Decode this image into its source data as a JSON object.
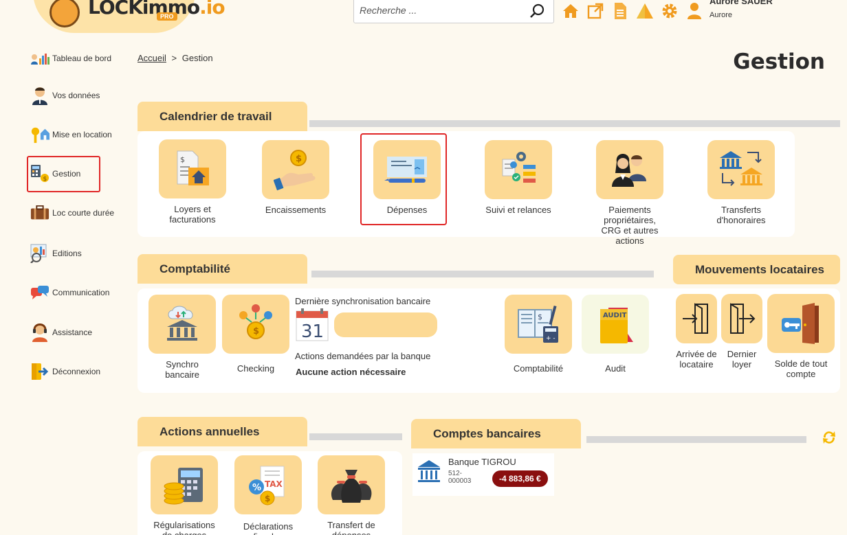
{
  "header": {
    "logo_main": "LOCKimmo",
    "logo_io": ".io",
    "logo_badge": "PRO",
    "search_placeholder": "Recherche ...",
    "user_name": "Aurore SAUER",
    "user_sub": "Aurore",
    "icons": [
      "home-icon",
      "external-link-icon",
      "document-icon",
      "alert-triangle-icon",
      "gear-icon",
      "user-icon"
    ]
  },
  "sidebar": {
    "items": [
      {
        "label": "Tableau de bord",
        "icon": "dashboard-icon"
      },
      {
        "label": "Vos données",
        "icon": "person-icon"
      },
      {
        "label": "Mise en location",
        "icon": "key-house-icon"
      },
      {
        "label": "Gestion",
        "icon": "calculator-icon",
        "active": true
      },
      {
        "label": "Loc courte durée",
        "icon": "suitcase-icon"
      },
      {
        "label": "Editions",
        "icon": "report-icon"
      },
      {
        "label": "Communication",
        "icon": "chat-icon"
      },
      {
        "label": "Assistance",
        "icon": "headset-icon"
      },
      {
        "label": "Déconnexion",
        "icon": "logout-icon"
      }
    ]
  },
  "breadcrumb": {
    "home": "Accueil",
    "separator": ">",
    "current": "Gestion"
  },
  "page_title": "Gestion",
  "calendrier": {
    "title": "Calendrier de travail",
    "tiles": [
      {
        "label": "Loyers et facturations",
        "icon": "invoice-house-icon"
      },
      {
        "label": "Encaissements",
        "icon": "hand-coin-icon"
      },
      {
        "label": "Dépenses",
        "icon": "check-pen-icon"
      },
      {
        "label": "Suivi et relances",
        "icon": "checklist-gear-icon"
      },
      {
        "label": "Paiements propriétaires, CRG et autres actions",
        "icon": "people-icon"
      },
      {
        "label": "Transferts d'honoraires",
        "icon": "bank-transfer-icon"
      }
    ]
  },
  "comptabilite": {
    "title": "Comptabilité",
    "tiles": [
      {
        "label": "Synchro bancaire",
        "icon": "cloud-bank-icon"
      },
      {
        "label": "Checking",
        "icon": "network-coin-icon"
      },
      {
        "label": "Comptabilité",
        "icon": "ledger-calculator-icon"
      },
      {
        "label": "Audit",
        "icon": "audit-folder-icon"
      }
    ],
    "sync_label": "Dernière synchronisation bancaire",
    "calendar_day": "31",
    "actions_label": "Actions demandées par la banque",
    "actions_value": "Aucune action nécessaire"
  },
  "mouvements": {
    "title": "Mouvements locataires",
    "tiles": [
      {
        "label": "Arrivée de locataire",
        "icon": "door-enter-icon"
      },
      {
        "label": "Dernier loyer",
        "icon": "door-exit-icon"
      },
      {
        "label": "Solde de tout compte",
        "icon": "key-door-icon"
      }
    ]
  },
  "annuelles": {
    "title": "Actions annuelles",
    "tiles": [
      {
        "label": "Régularisations de charges",
        "icon": "calculator-coins-icon"
      },
      {
        "label": "Déclarations fiscales",
        "icon": "tax-icon"
      },
      {
        "label": "Transfert de dépenses",
        "icon": "money-bags-icon"
      }
    ]
  },
  "comptes": {
    "title": "Comptes bancaires",
    "bank_name": "Banque TIGROU",
    "account": "512-000003",
    "balance": "-4 883,86 €"
  },
  "colors": {
    "accent": "#fcd994",
    "header_tab": "#fddc98",
    "highlight": "#e02626",
    "balance_bg": "#8a0f0f",
    "orange": "#f09b1f"
  }
}
